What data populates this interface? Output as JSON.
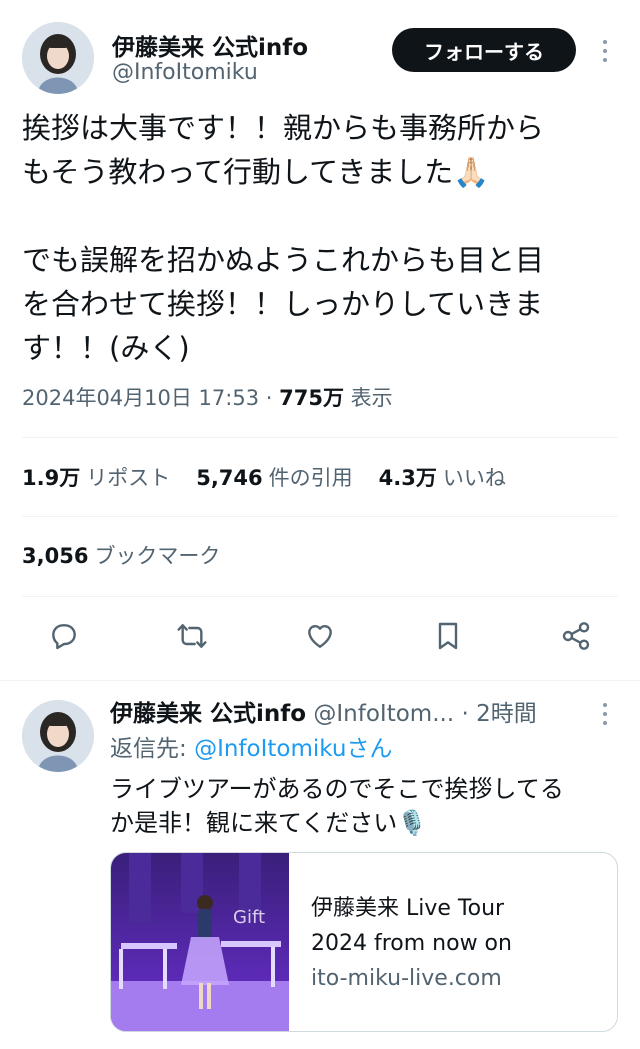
{
  "tweet": {
    "author_name": "伊藤美来 公式info",
    "author_handle": "@InfoItomiku",
    "follow_label": "フォローする",
    "text_line1": "挨拶は大事です！！親からも事務所から",
    "text_line2": "もそう教わって行動してきました🙏🏻",
    "text_line3": "でも誤解を招かぬようこれからも目と目",
    "text_line4": "を合わせて挨拶！！しっかりしていきま",
    "text_line5": "す！！(みく)",
    "timestamp": "2024年04月10日 17:53",
    "separator": " · ",
    "views_count": "775万",
    "views_label": " 表示",
    "reposts_count": "1.9万",
    "reposts_label": "リポスト",
    "quotes_count": "5,746",
    "quotes_label": "件の引用",
    "likes_count": "4.3万",
    "likes_label": "いいね",
    "bookmarks_count": "3,056",
    "bookmarks_label": "ブックマーク"
  },
  "actions": [
    "reply-icon",
    "retweet-icon",
    "heart-icon",
    "bookmark-icon",
    "share-icon"
  ],
  "reply": {
    "author_name": "伊藤美来 公式info",
    "author_handle": "@InfoItom...",
    "time": "2時間",
    "separator": " · ",
    "replying_to_prefix": "返信先: ",
    "replying_to_handle": "@InfoItomiku",
    "replying_to_suffix": "さん",
    "text_line1": "ライブツアーがあるのでそこで挨拶してる",
    "text_line2": "か是非！観に来てください🎙️",
    "card": {
      "title_line1": "伊藤美来 Live Tour",
      "title_line2": "2024 from now on",
      "domain": "ito-miku-live.com"
    }
  },
  "colors": {
    "text_primary": "#0f1419",
    "text_secondary": "#536471",
    "link": "#1d9bf0",
    "border": "#eff3f4"
  }
}
